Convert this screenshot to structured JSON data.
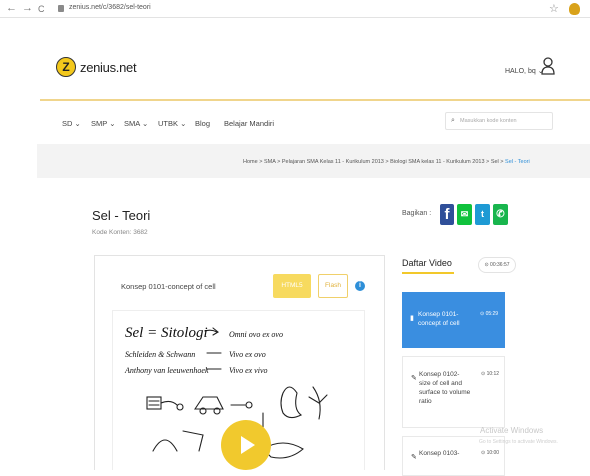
{
  "browser": {
    "back": "←",
    "forward": "→",
    "reload": "C",
    "url": "zenius.net/c/3682/sel-teori"
  },
  "header": {
    "logo_letter": "Z",
    "logo_text": "zenius.net",
    "greeting": "HALO, bq"
  },
  "nav": {
    "items": [
      "SD",
      "SMP",
      "SMA",
      "UTBK",
      "Blog",
      "Belajar Mandiri"
    ],
    "search_placeholder": "Masukkan kode konten"
  },
  "breadcrumb": {
    "items": [
      "Home",
      "SMA",
      "Pelajaran SMA Kelas 11 - Kurikulum 2013",
      "Biologi SMA kelas 11 - Kurikulum 2013",
      "Sel"
    ],
    "current": "Sel - Teori"
  },
  "page": {
    "title": "Sel - Teori",
    "kode": "Kode Konten: 3682"
  },
  "share": {
    "label": "Bagikan :",
    "facebook": "f",
    "line": "✉",
    "twitter": "t",
    "whatsapp": "✆"
  },
  "video": {
    "title": "Konsep 0101-concept of cell",
    "btn_html5": "HTML5",
    "btn_flash": "Flash",
    "info": "i",
    "notes": {
      "line1_a": "Sel = Sitologi",
      "line1_b": "Omni ovo ex ovo",
      "line2_a": "Schleiden & Schwann",
      "line2_b": "Vivo ex ovo",
      "line3_a": "Anthony van leeuwenhoek",
      "line3_b": "Vivo ex vivo"
    }
  },
  "sidebar": {
    "heading": "Daftar Video",
    "total_duration": "⊙ 00:36:57",
    "items": [
      {
        "title": "Konsep 0101-concept of cell",
        "duration": "⊙ 05:29",
        "active": true
      },
      {
        "title": "Konsep 0102-size of cell and surface to volume ratio",
        "duration": "⊙ 10:12",
        "active": false
      },
      {
        "title": "Konsep 0103-",
        "duration": "⊙ 10:00",
        "active": false
      }
    ]
  },
  "watermark": {
    "line1": "Activate Windows",
    "line2": "Go to Settings to activate Windows."
  },
  "colors": {
    "brand_yellow": "#f3c81c",
    "active_blue": "#3a8ee0",
    "facebook": "#2f4f99",
    "line": "#10c23c",
    "twitter": "#1e9ad4",
    "whatsapp": "#18b54d"
  }
}
